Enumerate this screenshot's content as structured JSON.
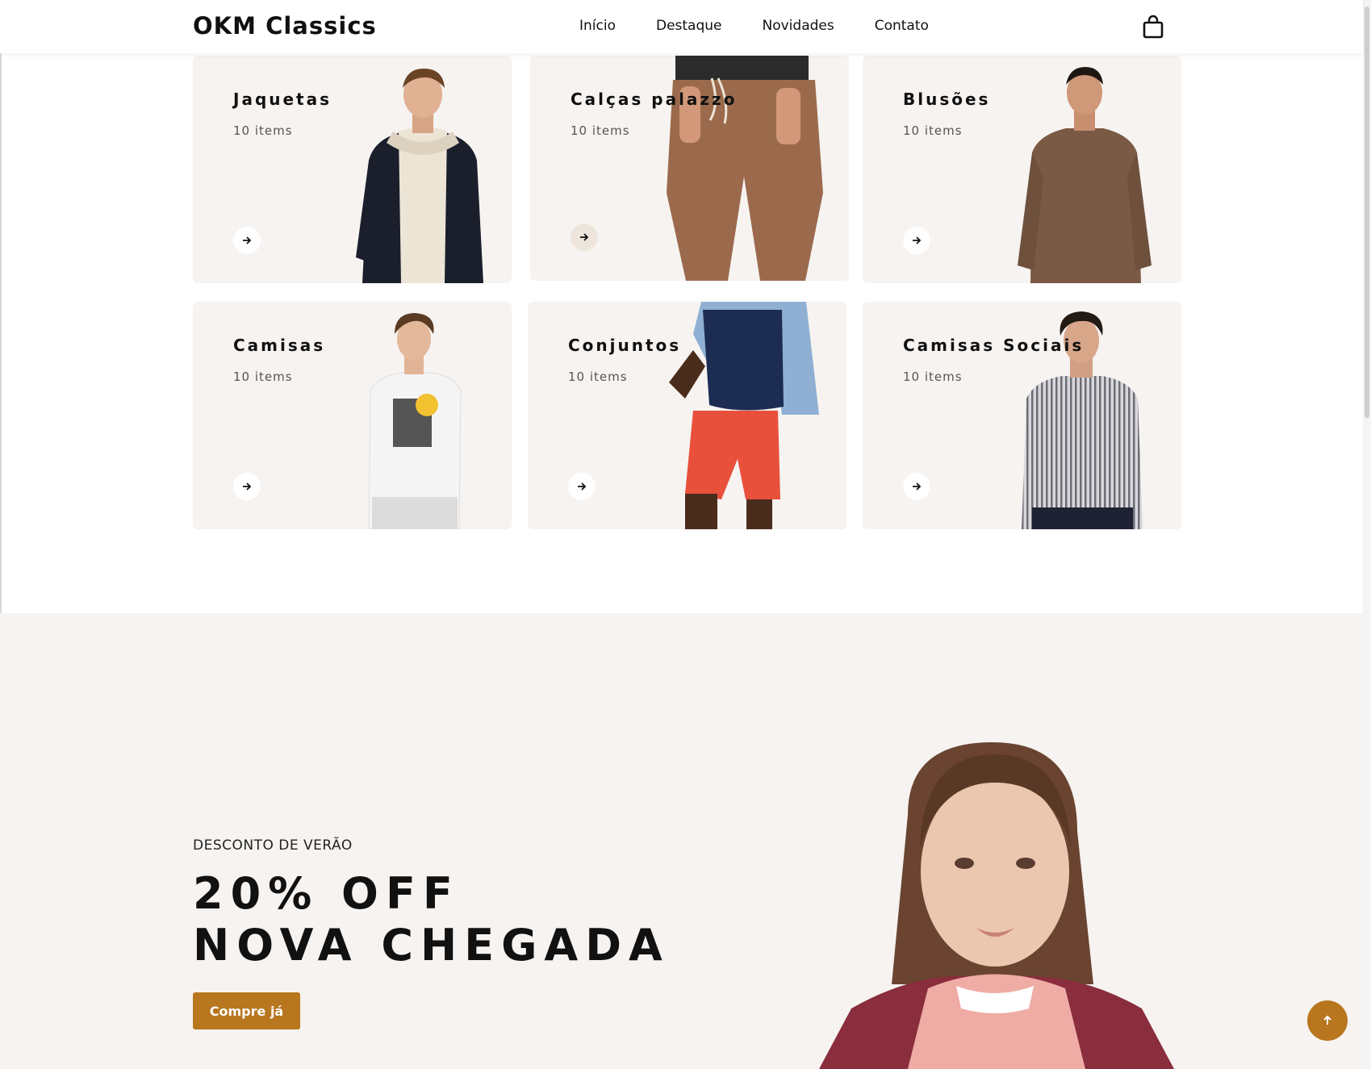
{
  "header": {
    "brand": "OKM Classics",
    "nav": [
      "Início",
      "Destaque",
      "Novidades",
      "Contato"
    ],
    "cart_icon": "shopping-bag-icon"
  },
  "categories": [
    {
      "title": "Jaquetas",
      "count": "10 items"
    },
    {
      "title": "Calças palazzo",
      "count": "10 items"
    },
    {
      "title": "Blusões",
      "count": "10 items"
    },
    {
      "title": "Camisas",
      "count": "10 items"
    },
    {
      "title": "Conjuntos",
      "count": "10 items"
    },
    {
      "title": "Camisas Sociais",
      "count": "10 items"
    }
  ],
  "promo": {
    "eyebrow": "DESCONTO DE VERÃO",
    "headline_line1": "20% OFF",
    "headline_line2": "NOVA CHEGADA",
    "cta": "Compre já"
  },
  "colors": {
    "accent": "#b8761f",
    "card_bg": "#f6f3f1"
  },
  "back_to_top_icon": "arrow-up-icon"
}
